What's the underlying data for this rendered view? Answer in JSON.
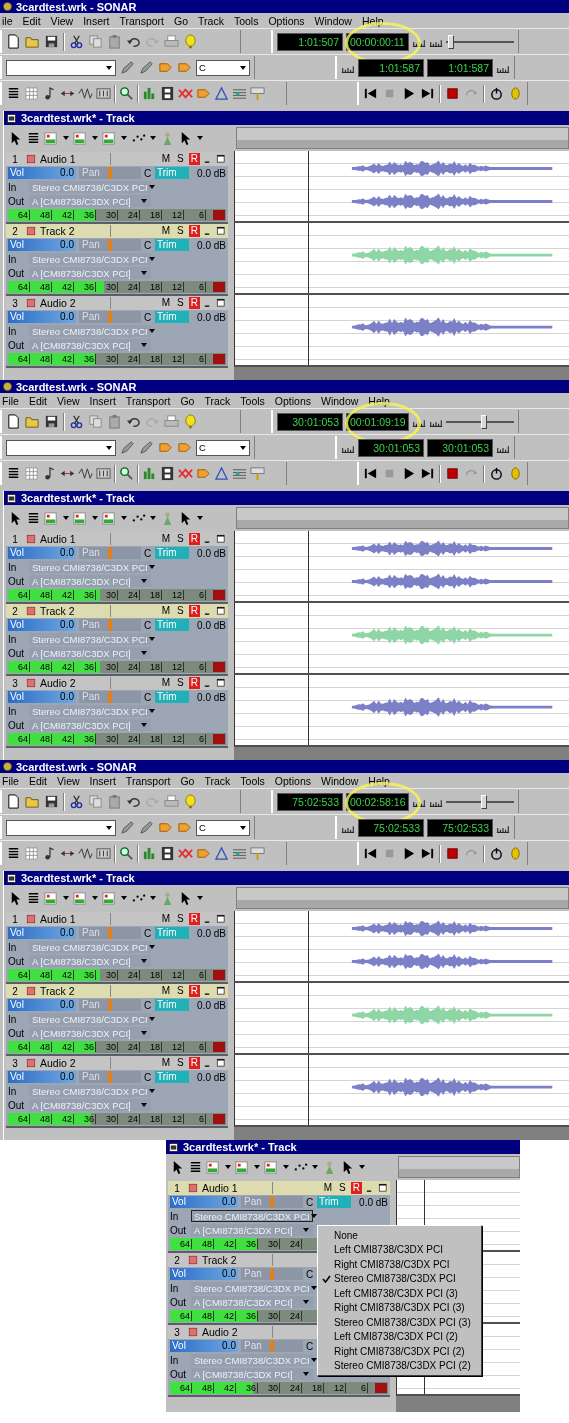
{
  "panels": [
    {
      "main_title": "3cardtest.wrk - SONAR",
      "menu": [
        "ile",
        "Edit",
        "View",
        "Insert",
        "Transport",
        "Go",
        "Track",
        "Tools",
        "Options",
        "Window",
        "Help"
      ],
      "now_time": "1:01:507",
      "smpte_time": "00:00:00:11",
      "smpte_highlighted": true,
      "position": {
        "level": 0.04
      },
      "key": "C",
      "from_time": "1:01:587",
      "thru_time": "1:01:587",
      "track_window_title": "3cardtest.wrk* - Track",
      "tracks": [
        {
          "number": "1",
          "name": "Audio 1",
          "selected": false,
          "mute": "M",
          "solo": "S",
          "arm": "R",
          "armed": true,
          "vol_label": "Vol",
          "vol_slider": {
            "level": 1
          },
          "vol": "0.0",
          "pan_label": "Pan",
          "pan_slider": {
            "level": 0.5
          },
          "pan": "C",
          "trim_label": "Trim",
          "trim_slider": {
            "level": 1
          },
          "trim": "0.0 dB",
          "in_label": "In",
          "input": "Stereo CMI8738/C3DX PCI",
          "out_label": "Out",
          "output": "A [CMI8738/C3DX PCI]",
          "meter": {
            "level": 0.4
          },
          "meter_ticks": [
            "64",
            "48",
            "42",
            "36",
            "30",
            "24",
            "18",
            "12",
            "6"
          ],
          "clip": true,
          "waveform": {
            "kind": "stereo",
            "color": "#7c80c6"
          }
        },
        {
          "number": "2",
          "name": "Track 2",
          "selected": true,
          "mute": "M",
          "solo": "S",
          "arm": "R",
          "armed": true,
          "vol_label": "Vol",
          "vol_slider": {
            "level": 1
          },
          "vol": "0.0",
          "pan_label": "Pan",
          "pan_slider": {
            "level": 0.5
          },
          "pan": "C",
          "trim_label": "Trim",
          "trim_slider": {
            "level": 1
          },
          "trim": "0.0 dB",
          "in_label": "In",
          "input": "Stereo CMI8738/C3DX PCI",
          "out_label": "Out",
          "output": "A [CMI8738/C3DX PCI]",
          "meter": {
            "level": 0.44
          },
          "meter_ticks": [
            "64",
            "48",
            "42",
            "36",
            "30",
            "24",
            "18",
            "12",
            "6"
          ],
          "clip": true,
          "waveform": {
            "kind": "mono",
            "color": "#8fd6a6"
          }
        },
        {
          "number": "3",
          "name": "Audio 2",
          "selected": false,
          "mute": "M",
          "solo": "S",
          "arm": "R",
          "armed": true,
          "vol_label": "Vol",
          "vol_slider": {
            "level": 1
          },
          "vol": "0.0",
          "pan_label": "Pan",
          "pan_slider": {
            "level": 0.5
          },
          "pan": "C",
          "trim_label": "Trim",
          "trim_slider": {
            "level": 1
          },
          "trim": "0.0 dB",
          "in_label": "In",
          "input": "Stereo CMI8738/C3DX PCI",
          "out_label": "Out",
          "output": "A [CMI8738/C3DX PCI]",
          "meter": {
            "level": 0.4
          },
          "meter_ticks": [
            "64",
            "48",
            "42",
            "36",
            "30",
            "24",
            "18",
            "12",
            "6"
          ],
          "clip": true,
          "waveform": {
            "kind": "mono",
            "color": "#7c80c6"
          }
        }
      ]
    },
    {
      "main_title": "3cardtest.wrk - SONAR",
      "menu": [
        "File",
        "Edit",
        "View",
        "Insert",
        "Transport",
        "Go",
        "Track",
        "Tools",
        "Options",
        "Window",
        "Help"
      ],
      "now_time": "30:01:053",
      "smpte_time": "00:01:09:19",
      "smpte_highlighted": true,
      "position": {
        "level": 0.55
      },
      "key": "C",
      "from_time": "30:01:053",
      "thru_time": "30:01:053",
      "track_window_title": "3cardtest.wrk* - Track",
      "tracks": [
        {
          "number": "1",
          "name": "Audio 1",
          "selected": false,
          "mute": "M",
          "solo": "S",
          "arm": "R",
          "armed": true,
          "vol_label": "Vol",
          "vol_slider": {
            "level": 1
          },
          "vol": "0.0",
          "pan_label": "Pan",
          "pan_slider": {
            "level": 0.5
          },
          "pan": "C",
          "trim_label": "Trim",
          "trim_slider": {
            "level": 1
          },
          "trim": "0.0 dB",
          "in_label": "In",
          "input": "Stereo CMI8738/C3DX PCI",
          "out_label": "Out",
          "output": "A [CMI8738/C3DX PCI]",
          "meter": {
            "level": 0.42
          },
          "meter_ticks": [
            "64",
            "48",
            "42",
            "36",
            "30",
            "24",
            "18",
            "12",
            "6"
          ],
          "clip": true,
          "waveform": {
            "kind": "stereo",
            "color": "#7c80c6"
          }
        },
        {
          "number": "2",
          "name": "Track 2",
          "selected": true,
          "mute": "M",
          "solo": "S",
          "arm": "R",
          "armed": true,
          "vol_label": "Vol",
          "vol_slider": {
            "level": 1
          },
          "vol": "0.0",
          "pan_label": "Pan",
          "pan_slider": {
            "level": 0.5
          },
          "pan": "C",
          "trim_label": "Trim",
          "trim_slider": {
            "level": 1
          },
          "trim": "0.0 dB",
          "in_label": "In",
          "input": "Stereo CMI8738/C3DX PCI",
          "out_label": "Out",
          "output": "A [CMI8738/C3DX PCI]",
          "meter": {
            "level": 0.42
          },
          "meter_ticks": [
            "64",
            "48",
            "42",
            "36",
            "30",
            "24",
            "18",
            "12",
            "6"
          ],
          "clip": true,
          "waveform": {
            "kind": "mono",
            "color": "#8fd6a6"
          }
        },
        {
          "number": "3",
          "name": "Audio 2",
          "selected": false,
          "mute": "M",
          "solo": "S",
          "arm": "R",
          "armed": true,
          "vol_label": "Vol",
          "vol_slider": {
            "level": 1
          },
          "vol": "0.0",
          "pan_label": "Pan",
          "pan_slider": {
            "level": 0.5
          },
          "pan": "C",
          "trim_label": "Trim",
          "trim_slider": {
            "level": 1
          },
          "trim": "0.0 dB",
          "in_label": "In",
          "input": "Stereo CMI8738/C3DX PCI",
          "out_label": "Out",
          "output": "A [CMI8738/C3DX PCI]",
          "meter": {
            "level": 0.4
          },
          "meter_ticks": [
            "64",
            "48",
            "42",
            "36",
            "30",
            "24",
            "18",
            "12",
            "6"
          ],
          "clip": true,
          "waveform": {
            "kind": "mono",
            "color": "#7c80c6"
          }
        }
      ]
    },
    {
      "main_title": "3cardtest.wrk - SONAR",
      "menu": [
        "File",
        "Edit",
        "View",
        "Insert",
        "Transport",
        "Go",
        "Track",
        "Tools",
        "Options",
        "Window",
        "Help"
      ],
      "now_time": "75:02:533",
      "smpte_time": "00:02:58:16",
      "smpte_highlighted": true,
      "position": {
        "level": 0.55
      },
      "key": "C",
      "from_time": "75:02:533",
      "thru_time": "75:02:533",
      "track_window_title": "3cardtest.wrk* - Track",
      "tracks": [
        {
          "number": "1",
          "name": "Audio 1",
          "selected": false,
          "mute": "M",
          "solo": "S",
          "arm": "R",
          "armed": true,
          "vol_label": "Vol",
          "vol_slider": {
            "level": 1
          },
          "vol": "0.0",
          "pan_label": "Pan",
          "pan_slider": {
            "level": 0.5
          },
          "pan": "C",
          "trim_label": "Trim",
          "trim_slider": {
            "level": 1
          },
          "trim": "0.0 dB",
          "in_label": "In",
          "input": "Stereo CMI8738/C3DX PCI",
          "out_label": "Out",
          "output": "A [CMI8738/C3DX PCI]",
          "meter": {
            "level": 0.42
          },
          "meter_ticks": [
            "64",
            "48",
            "42",
            "36",
            "30",
            "24",
            "18",
            "12",
            "6"
          ],
          "clip": true,
          "waveform": {
            "kind": "stereo",
            "color": "#7c80c6"
          }
        },
        {
          "number": "2",
          "name": "Track 2",
          "selected": true,
          "mute": "M",
          "solo": "S",
          "arm": "R",
          "armed": true,
          "vol_label": "Vol",
          "vol_slider": {
            "level": 1
          },
          "vol": "0.0",
          "pan_label": "Pan",
          "pan_slider": {
            "level": 0.5
          },
          "pan": "C",
          "trim_label": "Trim",
          "trim_slider": {
            "level": 1
          },
          "trim": "0.0 dB",
          "in_label": "In",
          "input": "Stereo CMI8738/C3DX PCI",
          "out_label": "Out",
          "output": "A [CMI8738/C3DX PCI]",
          "meter": {
            "level": 0.4
          },
          "meter_ticks": [
            "64",
            "48",
            "42",
            "36",
            "30",
            "24",
            "18",
            "12",
            "6"
          ],
          "clip": true,
          "waveform": {
            "kind": "mono",
            "color": "#8fd6a6"
          }
        },
        {
          "number": "3",
          "name": "Audio 2",
          "selected": false,
          "mute": "M",
          "solo": "S",
          "arm": "R",
          "armed": true,
          "vol_label": "Vol",
          "vol_slider": {
            "level": 1
          },
          "vol": "0.0",
          "pan_label": "Pan",
          "pan_slider": {
            "level": 0.5
          },
          "pan": "C",
          "trim_label": "Trim",
          "trim_slider": {
            "level": 1
          },
          "trim": "0.0 dB",
          "in_label": "In",
          "input": "Stereo CMI8738/C3DX PCI",
          "out_label": "Out",
          "output": "A [CMI8738/C3DX PCI]",
          "meter": {
            "level": 0.38
          },
          "meter_ticks": [
            "64",
            "48",
            "42",
            "36",
            "30",
            "24",
            "18",
            "12",
            "6"
          ],
          "clip": true,
          "waveform": {
            "kind": "mono",
            "color": "#7c80c6"
          }
        }
      ]
    }
  ],
  "input_menu_view": {
    "track_window_title": "3cardtest.wrk* - Track",
    "tracks": [
      {
        "number": "1",
        "name": "Audio 1",
        "selected": true,
        "mute": "M",
        "solo": "S",
        "arm": "R",
        "armed": true,
        "vol_label": "Vol",
        "vol_slider": {
          "level": 1
        },
        "vol": "0.0",
        "pan_label": "Pan",
        "pan_slider": {
          "level": 0.5
        },
        "pan": "C",
        "trim_label": "Trim",
        "trim_slider": {
          "level": 1
        },
        "trim": "0.0 dB",
        "in_label": "In",
        "input": "Stereo CMI8738/C3DX PCI",
        "input_open": true,
        "out_label": "Out",
        "output": "A [CMI8738/C3DX PCI]",
        "meter": {
          "level": 0.4
        },
        "meter_ticks": [
          "64",
          "48",
          "42",
          "36",
          "30",
          "24"
        ]
      },
      {
        "number": "2",
        "name": "Track 2",
        "selected": false,
        "vol_label": "Vol",
        "vol_slider": {
          "level": 1
        },
        "vol": "0.0",
        "pan_label": "Pan",
        "pan_slider": {
          "level": 0.5
        },
        "pan": "C",
        "in_label": "In",
        "input": "Stereo CMI8738/C3DX PCI",
        "input_open": false,
        "out_label": "Out",
        "output": "A [CMI8738/C3DX PCI]",
        "meter": {
          "level": 0.4
        },
        "meter_ticks": [
          "64",
          "48",
          "42",
          "36",
          "30",
          "24"
        ]
      },
      {
        "number": "3",
        "name": "Audio 2",
        "selected": false,
        "vol_label": "Vol",
        "vol_slider": {
          "level": 1
        },
        "vol": "0.0",
        "pan_label": "Pan",
        "pan_slider": {
          "level": 0.5
        },
        "pan": "C",
        "in_label": "In",
        "input": "Stereo CMI8738/C3DX PCI",
        "input_open": false,
        "out_label": "Out",
        "output": "A [CMI8738/C3DX PCI]",
        "meter": {
          "level": 0.38
        },
        "meter_ticks": [
          "64",
          "48",
          "42",
          "36",
          "30",
          "24",
          "18",
          "12",
          "6"
        ],
        "clip": true
      }
    ],
    "input_menu": [
      {
        "label": "None",
        "checked": false
      },
      {
        "label": "Left CMI8738/C3DX PCI",
        "checked": false
      },
      {
        "label": "Right CMI8738/C3DX PCI",
        "checked": false
      },
      {
        "label": "Stereo CMI8738/C3DX PCI",
        "checked": true
      },
      {
        "label": "Left CMI8738/C3DX PCI (3)",
        "checked": false
      },
      {
        "label": "Right CMI8738/C3DX PCI (3)",
        "checked": false
      },
      {
        "label": "Stereo CMI8738/C3DX PCI (3)",
        "checked": false
      },
      {
        "label": "Left CMI8738/C3DX PCI (2)",
        "checked": false
      },
      {
        "label": "Right CMI8738/C3DX PCI (2)",
        "checked": false
      },
      {
        "label": "Stereo CMI8738/C3DX PCI (2)",
        "checked": false
      }
    ]
  }
}
